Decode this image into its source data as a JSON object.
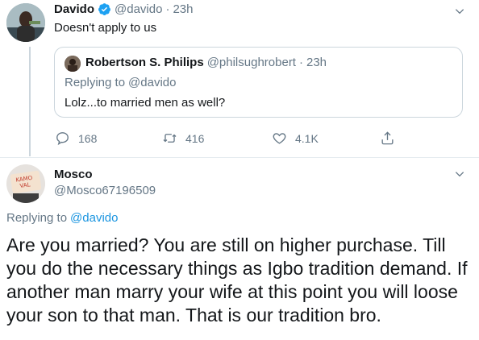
{
  "tweet": {
    "author_name": "Davido",
    "handle": "@davido",
    "separator": "·",
    "time": "23h",
    "text": "Doesn't apply to us",
    "verified_icon": "verified-badge-icon",
    "quote": {
      "author_name": "Robertson S. Philips",
      "handle": "@philsughrobert",
      "separator": "·",
      "time": "23h",
      "replying_prefix": "Replying to",
      "replying_handle": "@davido",
      "text": "Lolz...to married men as well?"
    },
    "actions": {
      "reply_count": "168",
      "retweet_count": "416",
      "like_count": "4.1K"
    }
  },
  "reply": {
    "author_name": "Mosco",
    "handle": "@Mosco67196509",
    "replying_prefix": "Replying to",
    "replying_handle": "@davido",
    "text": "Are you married? You are still on higher purchase. Till you do the necessary things as Igbo tradition demand. If another man marry your wife at this point you will loose your son to that man. That is our tradition bro.",
    "avatar_text": "KAMO VAL"
  },
  "colors": {
    "accent": "#1da1f2",
    "link": "#1b95e0",
    "muted": "#657786",
    "border": "#ccd6dd"
  }
}
